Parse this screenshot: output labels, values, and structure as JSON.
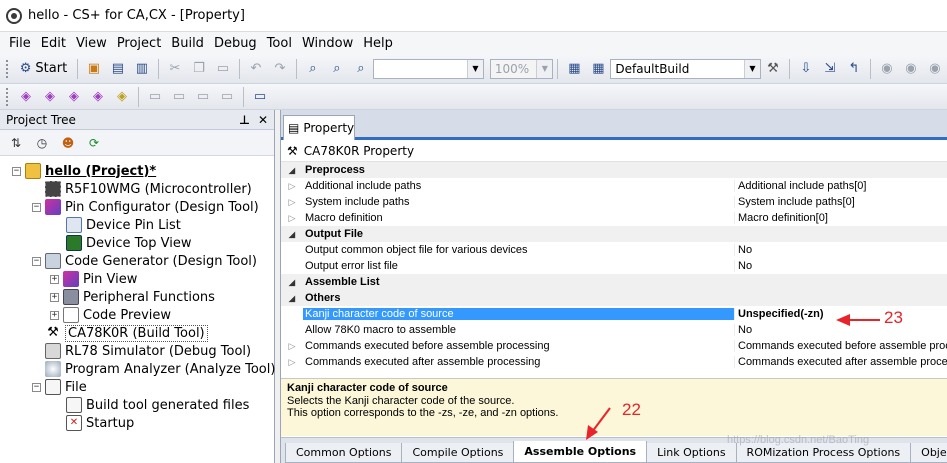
{
  "window": {
    "title": "hello - CS+ for CA,CX - [Property]"
  },
  "menu": [
    "File",
    "Edit",
    "View",
    "Project",
    "Build",
    "Debug",
    "Tool",
    "Window",
    "Help"
  ],
  "toolbar": {
    "start_label": "Start",
    "zoom": "100%",
    "build_config": "DefaultBuild"
  },
  "project_tree": {
    "title": "Project Tree",
    "nodes": [
      {
        "label": "hello (Project)*"
      },
      {
        "label": "R5F10WMG (Microcontroller)"
      },
      {
        "label": "Pin Configurator (Design Tool)"
      },
      {
        "label": "Device Pin List"
      },
      {
        "label": "Device Top View"
      },
      {
        "label": "Code Generator (Design Tool)"
      },
      {
        "label": "Pin View"
      },
      {
        "label": "Peripheral Functions"
      },
      {
        "label": "Code Preview"
      },
      {
        "label": "CA78K0R (Build Tool)"
      },
      {
        "label": "RL78 Simulator (Debug Tool)"
      },
      {
        "label": "Program Analyzer (Analyze Tool)"
      },
      {
        "label": "File"
      },
      {
        "label": "Build tool generated files"
      },
      {
        "label": "Startup"
      }
    ]
  },
  "property": {
    "tab_label": "Property",
    "header": "CA78K0R Property",
    "rows": [
      {
        "name": "Preprocess",
        "value": "",
        "category": true
      },
      {
        "name": "Additional include paths",
        "value": "Additional include paths[0]"
      },
      {
        "name": "System include paths",
        "value": "System include paths[0]"
      },
      {
        "name": "Macro definition",
        "value": "Macro definition[0]"
      },
      {
        "name": "Output File",
        "value": "",
        "category": true
      },
      {
        "name": "Output common object file for various devices",
        "value": "No"
      },
      {
        "name": "Output error list file",
        "value": "No"
      },
      {
        "name": "Assemble List",
        "value": "",
        "category": true
      },
      {
        "name": "Others",
        "value": "",
        "category": true
      },
      {
        "name": "Kanji character code of source",
        "value": "Unspecified(-zn)",
        "selected": true
      },
      {
        "name": "Allow 78K0 macro to assemble",
        "value": "No"
      },
      {
        "name": "Commands executed before assemble processing",
        "value": "Commands executed before assemble processing"
      },
      {
        "name": "Commands executed after assemble processing",
        "value": "Commands executed after assemble processing"
      }
    ],
    "description": {
      "title": "Kanji character code of source",
      "line1": "Selects the Kanji character code of the source.",
      "line2": "This option corresponds to the -zs, -ze, and -zn options."
    },
    "bottom_tabs": [
      "Common Options",
      "Compile Options",
      "Assemble Options",
      "Link Options",
      "ROMization Process Options",
      "Object Co"
    ]
  },
  "annotations": {
    "label_23": "23",
    "label_22": "22",
    "color": "#e8232a"
  },
  "watermark": "https://blog.csdn.net/BaoTing"
}
